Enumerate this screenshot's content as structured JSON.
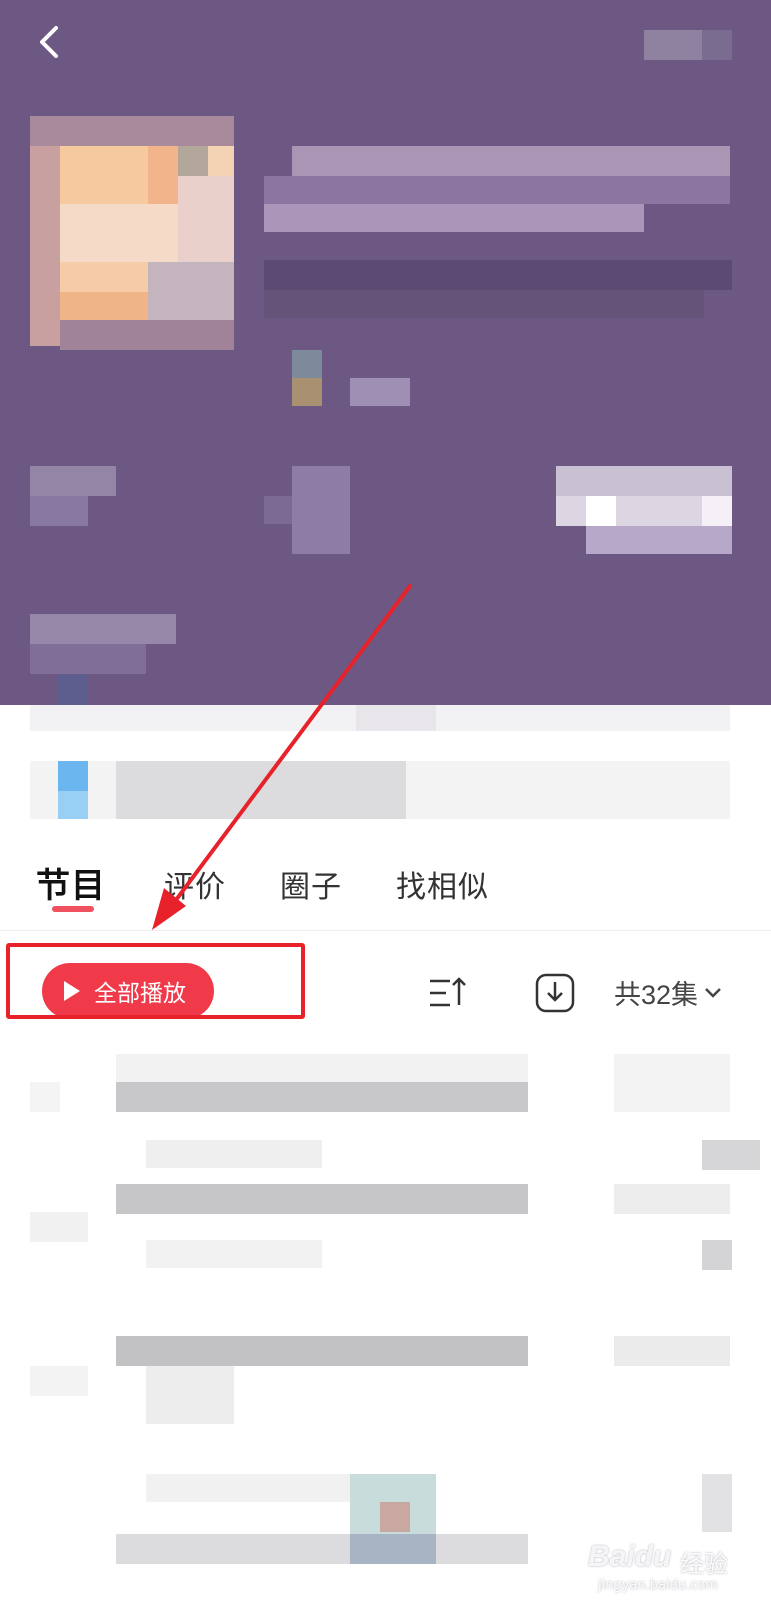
{
  "colors": {
    "header_bg": "#6c5883",
    "accent_red": "#f03a4a",
    "tab_indicator": "#f0515e",
    "annotation_red": "#e8222a"
  },
  "nav": {
    "back_icon": "chevron-left-icon"
  },
  "tabs": [
    {
      "label": "节目",
      "active": true
    },
    {
      "label": "评价",
      "active": false
    },
    {
      "label": "圈子",
      "active": false
    },
    {
      "label": "找相似",
      "active": false
    }
  ],
  "toolbar": {
    "play_all_label": "全部播放",
    "sort_icon": "sort-icon",
    "download_icon": "download-icon",
    "episode_count": "共32集",
    "dropdown_icon": "chevron-down-icon"
  },
  "watermark": {
    "logo": "Bai",
    "logo_suffix": "du",
    "cn": "经验",
    "url": "jingyan.baidu.com"
  }
}
